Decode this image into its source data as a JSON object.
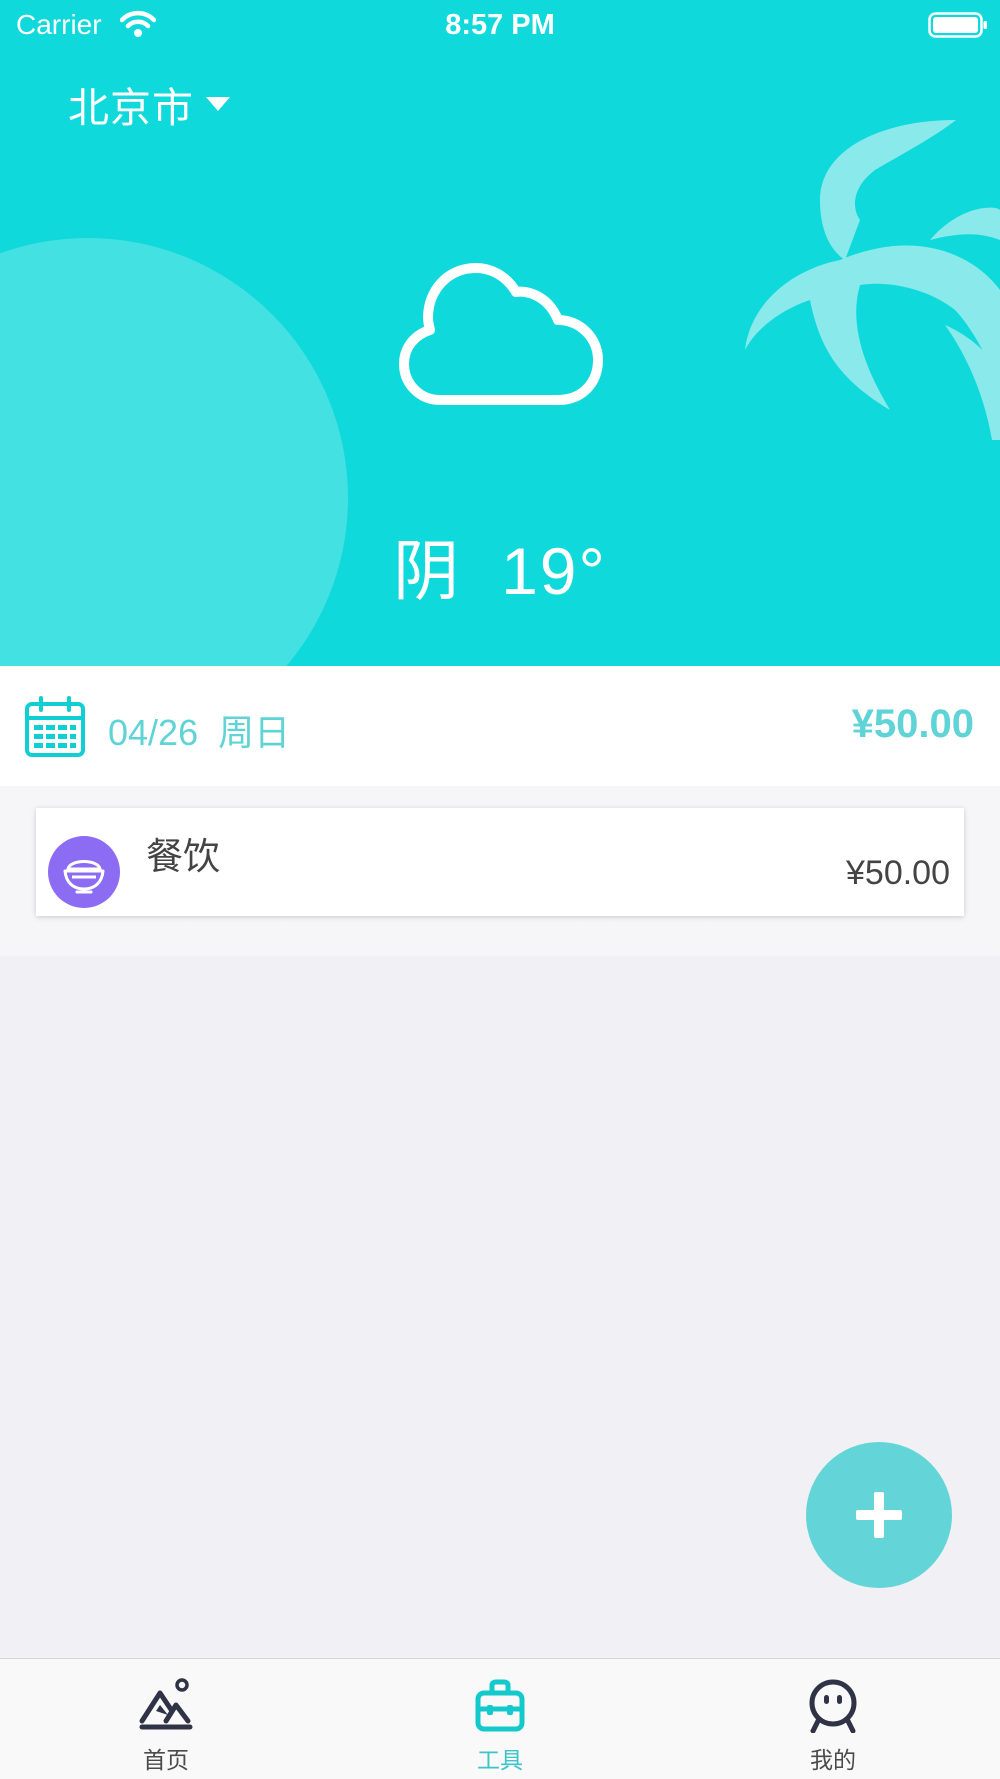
{
  "status_bar": {
    "carrier": "Carrier",
    "time": "8:57 PM"
  },
  "header": {
    "city": "北京市",
    "weather_icon": "cloud-icon",
    "condition": "阴",
    "temperature": "19°"
  },
  "date_bar": {
    "date": "04/26",
    "weekday": "周日",
    "total": "¥50.00"
  },
  "records": [
    {
      "icon": "rice-bowl-icon",
      "icon_color": "#8b6cf3",
      "category": "餐饮",
      "amount": "¥50.00"
    }
  ],
  "fab": {
    "icon": "plus-icon"
  },
  "tab_bar": {
    "tabs": [
      {
        "label": "首页",
        "icon": "mountain-icon",
        "active": false
      },
      {
        "label": "工具",
        "icon": "toolbox-icon",
        "active": true
      },
      {
        "label": "我的",
        "icon": "person-icon",
        "active": false
      }
    ]
  },
  "colors": {
    "accent": "#10d9db",
    "accent_text": "#5fd3d6",
    "fab": "#63d5d8",
    "category_purple": "#8b6cf3",
    "tab_active": "#3dc4c8"
  }
}
